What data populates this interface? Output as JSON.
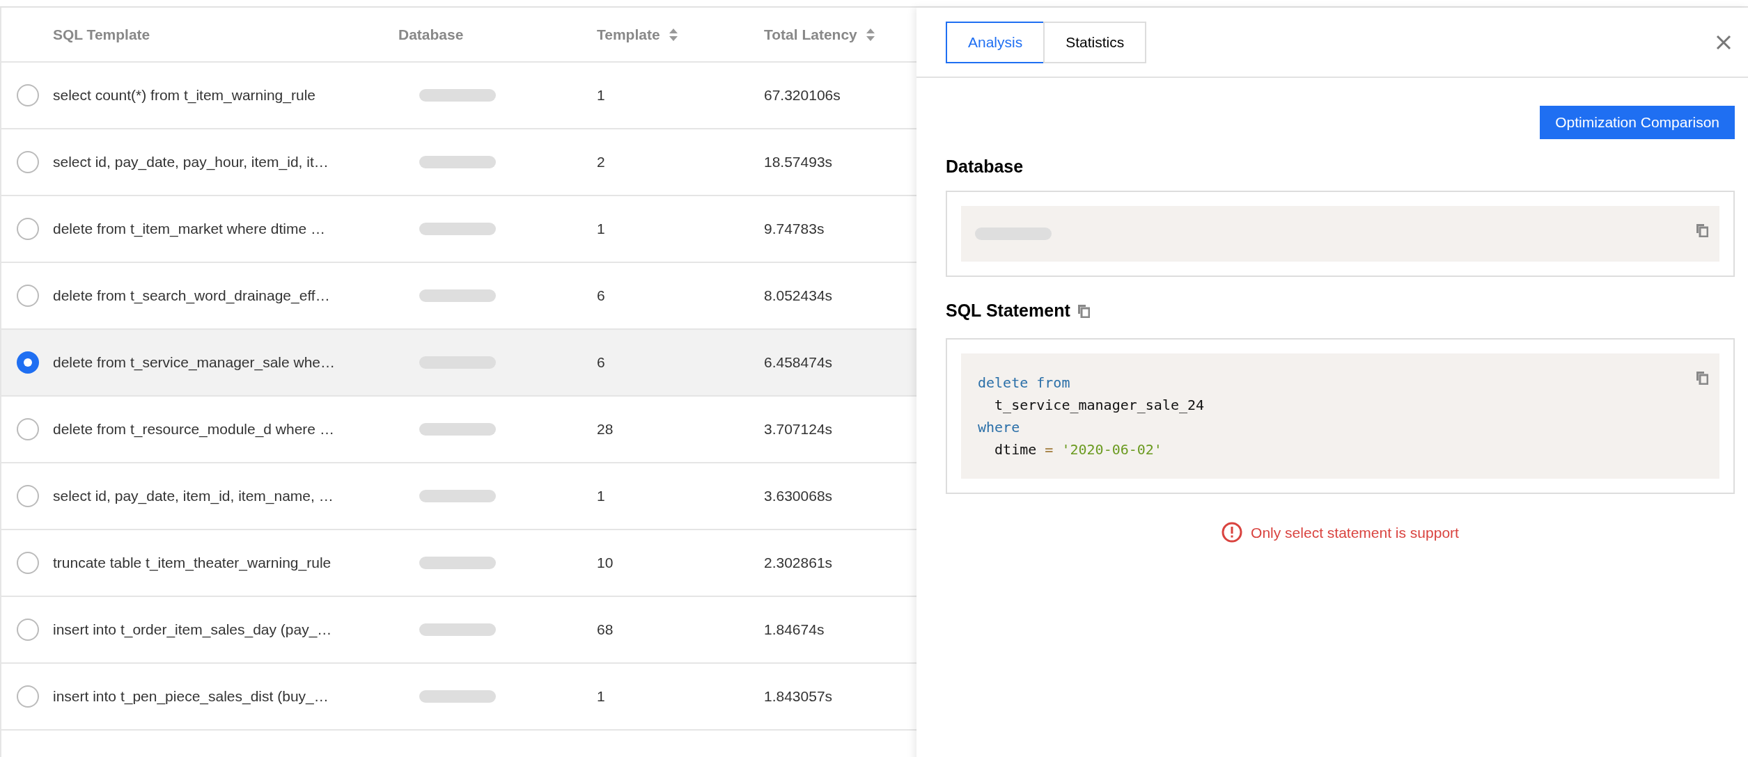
{
  "table": {
    "columns": [
      {
        "label": "SQL Template",
        "sortable": false
      },
      {
        "label": "Database",
        "sortable": false
      },
      {
        "label": "Template",
        "sortable": true
      },
      {
        "label": "Total Latency",
        "sortable": true
      }
    ],
    "rows": [
      {
        "selected": false,
        "sql": "select count(*) from t_item_warning_rule",
        "template": "1",
        "latency": "67.320106s"
      },
      {
        "selected": false,
        "sql": "select id, pay_date, pay_hour, item_id, it…",
        "template": "2",
        "latency": "18.57493s"
      },
      {
        "selected": false,
        "sql": "delete from t_item_market where dtime …",
        "template": "1",
        "latency": "9.74783s"
      },
      {
        "selected": false,
        "sql": "delete from t_search_word_drainage_eff…",
        "template": "6",
        "latency": "8.052434s"
      },
      {
        "selected": true,
        "sql": "delete from t_service_manager_sale whe…",
        "template": "6",
        "latency": "6.458474s"
      },
      {
        "selected": false,
        "sql": "delete from t_resource_module_d where …",
        "template": "28",
        "latency": "3.707124s"
      },
      {
        "selected": false,
        "sql": "select id, pay_date, item_id, item_name, …",
        "template": "1",
        "latency": "3.630068s"
      },
      {
        "selected": false,
        "sql": "truncate table t_item_theater_warning_rule",
        "template": "10",
        "latency": "2.302861s"
      },
      {
        "selected": false,
        "sql": "insert into t_order_item_sales_day (pay_…",
        "template": "68",
        "latency": "1.84674s"
      },
      {
        "selected": false,
        "sql": "insert into t_pen_piece_sales_dist (buy_…",
        "template": "1",
        "latency": "1.843057s"
      }
    ]
  },
  "panel": {
    "tabs": [
      {
        "label": "Analysis",
        "selected": true
      },
      {
        "label": "Statistics",
        "selected": false
      }
    ],
    "button": "Optimization Comparison",
    "database_heading": "Database",
    "sql_heading": "SQL Statement",
    "sql_lines": [
      [
        {
          "kind": "keyword",
          "text": "delete from"
        }
      ],
      [
        {
          "kind": "plain",
          "text": "  t_service_manager_sale_24"
        }
      ],
      [
        {
          "kind": "keyword",
          "text": "where"
        }
      ],
      [
        {
          "kind": "plain",
          "text": "  dtime "
        },
        {
          "kind": "operator",
          "text": "= "
        },
        {
          "kind": "string",
          "text": "'2020-06-02'"
        }
      ]
    ],
    "error": "Only select statement is support"
  }
}
